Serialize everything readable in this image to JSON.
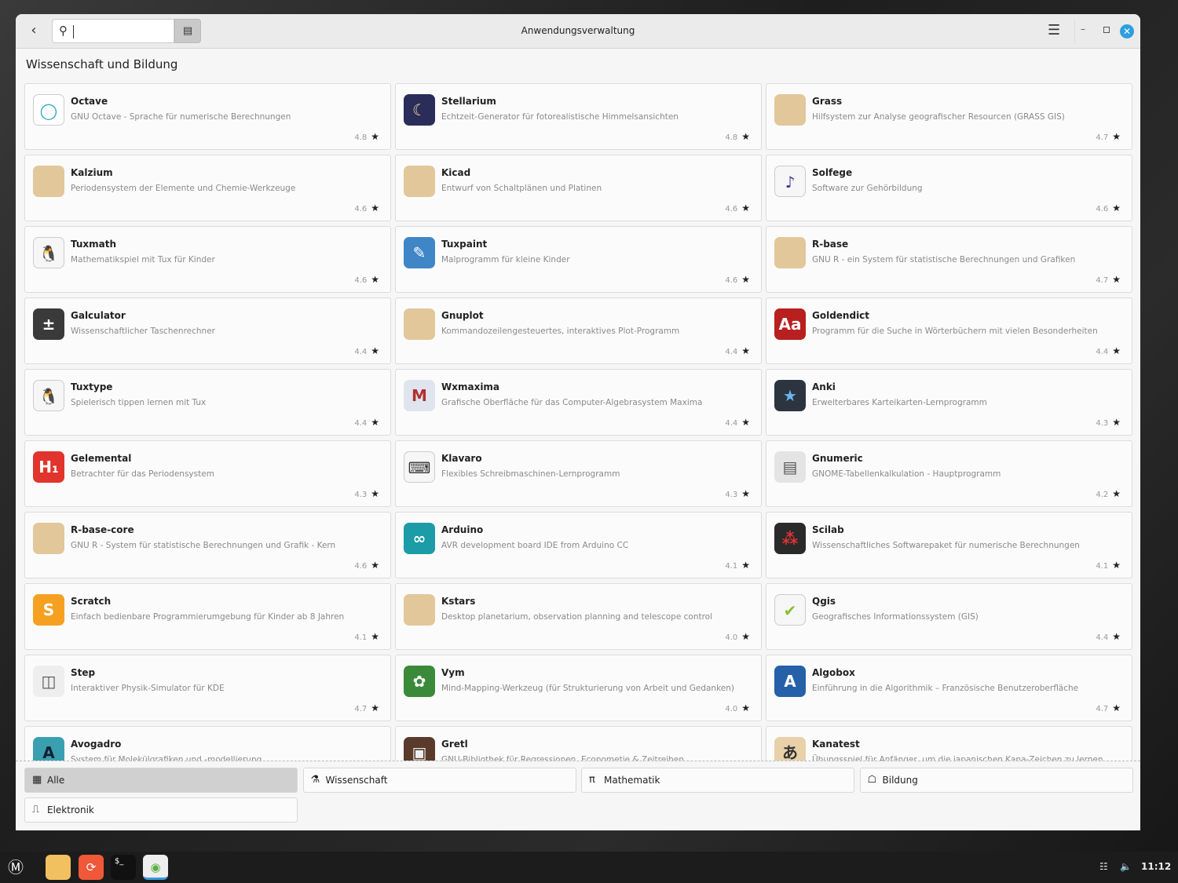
{
  "window": {
    "title": "Anwendungsverwaltung",
    "search_value": "",
    "section_title": "Wissenschaft und Bildung"
  },
  "apps": [
    {
      "name": "Octave",
      "desc": "GNU Octave - Sprache für numerische Berechnungen",
      "rating": "4.8",
      "icon": "octave-icon",
      "color": "#ffffff",
      "glyph": "◯",
      "fg": "#2aa0c8"
    },
    {
      "name": "Stellarium",
      "desc": "Echtzeit-Generator für fotorealistische Himmelsansichten",
      "rating": "4.8",
      "icon": "stellarium-icon",
      "color": "#2a2c5a",
      "glyph": "☾",
      "fg": "#f4d9a0"
    },
    {
      "name": "Grass",
      "desc": "Hilfsystem zur Analyse geografischer Resourcen (GRASS GIS)",
      "rating": "4.7",
      "icon": "package-icon",
      "color": "#e2c79a",
      "glyph": "",
      "fg": "#fff"
    },
    {
      "name": "Kalzium",
      "desc": "Periodensystem der Elemente und Chemie-Werkzeuge",
      "rating": "4.6",
      "icon": "package-icon",
      "color": "#e2c79a",
      "glyph": "",
      "fg": "#fff"
    },
    {
      "name": "Kicad",
      "desc": "Entwurf von Schaltplänen und Platinen",
      "rating": "4.6",
      "icon": "package-icon",
      "color": "#e2c79a",
      "glyph": "",
      "fg": "#fff"
    },
    {
      "name": "Solfege",
      "desc": "Software zur Gehörbildung",
      "rating": "4.6",
      "icon": "solfege-icon",
      "color": "#f6f6f6",
      "glyph": "♪",
      "fg": "#3a3a8a"
    },
    {
      "name": "Tuxmath",
      "desc": "Mathematikspiel mit Tux für Kinder",
      "rating": "4.6",
      "icon": "tuxmath-icon",
      "color": "#f6f6f6",
      "glyph": "🐧",
      "fg": "#222"
    },
    {
      "name": "Tuxpaint",
      "desc": "Malprogramm für kleine Kinder",
      "rating": "4.6",
      "icon": "tuxpaint-icon",
      "color": "#3f86c6",
      "glyph": "✎",
      "fg": "#fff"
    },
    {
      "name": "R-base",
      "desc": "GNU R - ein System für statistische Berechnungen und Grafiken",
      "rating": "4.7",
      "icon": "package-icon",
      "color": "#e2c79a",
      "glyph": "",
      "fg": "#fff"
    },
    {
      "name": "Galculator",
      "desc": "Wissenschaftlicher Taschenrechner",
      "rating": "4.4",
      "icon": "calculator-icon",
      "color": "#3a3a3a",
      "glyph": "±",
      "fg": "#fff"
    },
    {
      "name": "Gnuplot",
      "desc": "Kommandozeilengesteuertes, interaktives Plot-Programm",
      "rating": "4.4",
      "icon": "package-icon",
      "color": "#e2c79a",
      "glyph": "",
      "fg": "#fff"
    },
    {
      "name": "Goldendict",
      "desc": "Programm für die Suche in Wörterbüchern mit vielen Besonderheiten",
      "rating": "4.4",
      "icon": "goldendict-icon",
      "color": "#b81f1f",
      "glyph": "Aa",
      "fg": "#fff"
    },
    {
      "name": "Tuxtype",
      "desc": "Spielerisch tippen lernen mit Tux",
      "rating": "4.4",
      "icon": "tuxtype-icon",
      "color": "#f6f6f6",
      "glyph": "🐧",
      "fg": "#222"
    },
    {
      "name": "Wxmaxima",
      "desc": "Grafische Oberfläche für das Computer-Algebrasystem Maxima",
      "rating": "4.4",
      "icon": "wxmaxima-icon",
      "color": "#dfe4ee",
      "glyph": "M",
      "fg": "#b03030"
    },
    {
      "name": "Anki",
      "desc": "Erweiterbares Karteikarten-Lernprogramm",
      "rating": "4.3",
      "icon": "anki-icon",
      "color": "#2c3440",
      "glyph": "★",
      "fg": "#6ab4f0"
    },
    {
      "name": "Gelemental",
      "desc": "Betrachter für das Periodensystem",
      "rating": "4.3",
      "icon": "gelemental-icon",
      "color": "#e0342c",
      "glyph": "H₁",
      "fg": "#fff"
    },
    {
      "name": "Klavaro",
      "desc": "Flexibles Schreibmaschinen-Lernprogramm",
      "rating": "4.3",
      "icon": "klavaro-icon",
      "color": "#f6f6f6",
      "glyph": "⌨",
      "fg": "#333"
    },
    {
      "name": "Gnumeric",
      "desc": "GNOME-Tabellenkalkulation - Hauptprogramm",
      "rating": "4.2",
      "icon": "gnumeric-icon",
      "color": "#e4e4e4",
      "glyph": "▤",
      "fg": "#555"
    },
    {
      "name": "R-base-core",
      "desc": "GNU R - System für statistische Berechnungen und Grafik - Kern",
      "rating": "4.6",
      "icon": "package-icon",
      "color": "#e2c79a",
      "glyph": "",
      "fg": "#fff"
    },
    {
      "name": "Arduino",
      "desc": "AVR development board IDE from Arduino CC",
      "rating": "4.1",
      "icon": "arduino-icon",
      "color": "#1b9ca6",
      "glyph": "∞",
      "fg": "#fff"
    },
    {
      "name": "Scilab",
      "desc": "Wissenschaftliches Softwarepaket für numerische Berechnungen",
      "rating": "4.1",
      "icon": "scilab-icon",
      "color": "#2a2a2a",
      "glyph": "⁂",
      "fg": "#d33"
    },
    {
      "name": "Scratch",
      "desc": "Einfach bedienbare Programmierumgebung für Kinder ab 8 Jahren",
      "rating": "4.1",
      "icon": "scratch-icon",
      "color": "#f5a020",
      "glyph": "S",
      "fg": "#fff"
    },
    {
      "name": "Kstars",
      "desc": "Desktop planetarium, observation planning and telescope control",
      "rating": "4.0",
      "icon": "package-icon",
      "color": "#e2c79a",
      "glyph": "",
      "fg": "#fff"
    },
    {
      "name": "Qgis",
      "desc": "Geografisches Informationssystem (GIS)",
      "rating": "4.4",
      "icon": "qgis-icon",
      "color": "#f6f6f6",
      "glyph": "✔",
      "fg": "#8ac030"
    },
    {
      "name": "Step",
      "desc": "Interaktiver Physik-Simulator für KDE",
      "rating": "4.7",
      "icon": "step-icon",
      "color": "#eeeeee",
      "glyph": "◫",
      "fg": "#555"
    },
    {
      "name": "Vym",
      "desc": "Mind-Mapping-Werkzeug (für Strukturierung von Arbeit und Gedanken)",
      "rating": "4.0",
      "icon": "vym-icon",
      "color": "#3a8a3a",
      "glyph": "✿",
      "fg": "#fff"
    },
    {
      "name": "Algobox",
      "desc": "Einführung in die Algorithmik – Französische Benutzeroberfläche",
      "rating": "4.7",
      "icon": "algobox-icon",
      "color": "#2560a8",
      "glyph": "A",
      "fg": "#fff"
    },
    {
      "name": "Avogadro",
      "desc": "System für Molekülgrafiken und -modellierung",
      "rating": "",
      "icon": "avogadro-icon",
      "color": "#3aa0b0",
      "glyph": "A",
      "fg": "#123"
    },
    {
      "name": "Gretl",
      "desc": "GNU-Bibliothek für Regressionen, Econometie & Zeitreihen",
      "rating": "",
      "icon": "gretl-icon",
      "color": "#5a3a2a",
      "glyph": "▣",
      "fg": "#eee"
    },
    {
      "name": "Kanatest",
      "desc": "Übungsspiel für Anfänger, um die japanischen Kana-Zeichen zu lernen",
      "rating": "",
      "icon": "kanatest-icon",
      "color": "#e8d0a8",
      "glyph": "あ",
      "fg": "#333"
    }
  ],
  "categories": [
    {
      "label": "Alle",
      "icon": "▦",
      "selected": true
    },
    {
      "label": "Wissenschaft",
      "icon": "⚗",
      "selected": false
    },
    {
      "label": "Mathematik",
      "icon": "π",
      "selected": false
    },
    {
      "label": "Bildung",
      "icon": "☖",
      "selected": false
    },
    {
      "label": "Elektronik",
      "icon": "⎍",
      "selected": false
    }
  ],
  "taskbar": {
    "clock": "11:12"
  },
  "accent": "#2d9fe0"
}
